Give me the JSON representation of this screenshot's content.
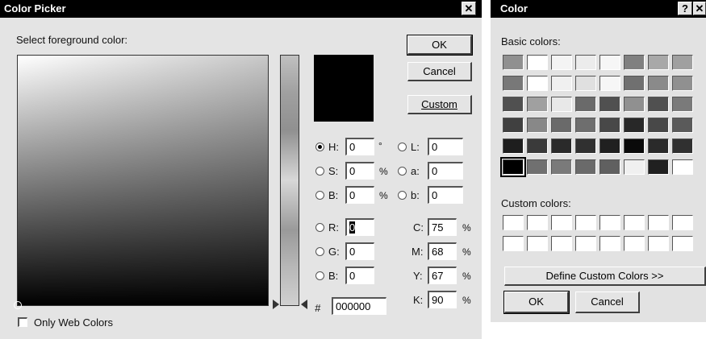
{
  "picker": {
    "title": "Color Picker",
    "close_glyph": "✕",
    "prompt": "Select foreground color:",
    "ok_label": "OK",
    "cancel_label": "Cancel",
    "custom_label": "Custom",
    "only_web_colors_label": "Only Web Colors",
    "only_web_colors_checked": false,
    "degree_unit": "°",
    "percent_unit": "%",
    "hex_prefix": "#",
    "hex_value": "000000",
    "selected_color": "#000000",
    "fields": {
      "H": {
        "label": "H:",
        "value": "0"
      },
      "S": {
        "label": "S:",
        "value": "0"
      },
      "Bhsb": {
        "label": "B:",
        "value": "0"
      },
      "R": {
        "label": "R:",
        "value": "0"
      },
      "G": {
        "label": "G:",
        "value": "0"
      },
      "Brgb": {
        "label": "B:",
        "value": "0"
      },
      "L": {
        "label": "L:",
        "value": "0"
      },
      "a": {
        "label": "a:",
        "value": "0"
      },
      "blab": {
        "label": "b:",
        "value": "0"
      },
      "C": {
        "label": "C:",
        "value": "75"
      },
      "M": {
        "label": "M:",
        "value": "68"
      },
      "Y": {
        "label": "Y:",
        "value": "67"
      },
      "K": {
        "label": "K:",
        "value": "90"
      }
    },
    "selected_mode": "H"
  },
  "color_dialog": {
    "title": "Color",
    "help_glyph": "?",
    "close_glyph": "✕",
    "basic_colors_label": "Basic colors:",
    "custom_colors_label": "Custom colors:",
    "define_label": "Define Custom Colors >>",
    "ok_label": "OK",
    "cancel_label": "Cancel",
    "basic_swatches": [
      [
        "#909090",
        "#ffffff",
        "#f4f4f4",
        "#ececec",
        "#f6f6f6",
        "#808080",
        "#a8a8a8",
        "#a0a0a0"
      ],
      [
        "#787878",
        "#ffffff",
        "#f0f0f0",
        "#e0e0e0",
        "#f6f6f6",
        "#707070",
        "#8a8a8a",
        "#909090"
      ],
      [
        "#505050",
        "#a0a0a0",
        "#e8e8e8",
        "#6a6a6a",
        "#505050",
        "#909090",
        "#505050",
        "#7a7a7a"
      ],
      [
        "#404040",
        "#888888",
        "#6a6a6a",
        "#6e6e6e",
        "#484848",
        "#282828",
        "#484848",
        "#5a5a5a"
      ],
      [
        "#1e1e1e",
        "#3a3a3a",
        "#2a2a2a",
        "#303030",
        "#202020",
        "#0a0a0a",
        "#2a2a2a",
        "#303030"
      ],
      [
        "#000000",
        "#707070",
        "#7a7a7a",
        "#6a6a6a",
        "#606060",
        "#f0f0f0",
        "#202020",
        "#ffffff"
      ]
    ],
    "custom_swatches": [
      [
        "#ffffff",
        "#ffffff",
        "#ffffff",
        "#ffffff",
        "#ffffff",
        "#ffffff",
        "#ffffff",
        "#ffffff"
      ],
      [
        "#ffffff",
        "#ffffff",
        "#ffffff",
        "#ffffff",
        "#ffffff",
        "#ffffff",
        "#ffffff",
        "#ffffff"
      ]
    ]
  }
}
